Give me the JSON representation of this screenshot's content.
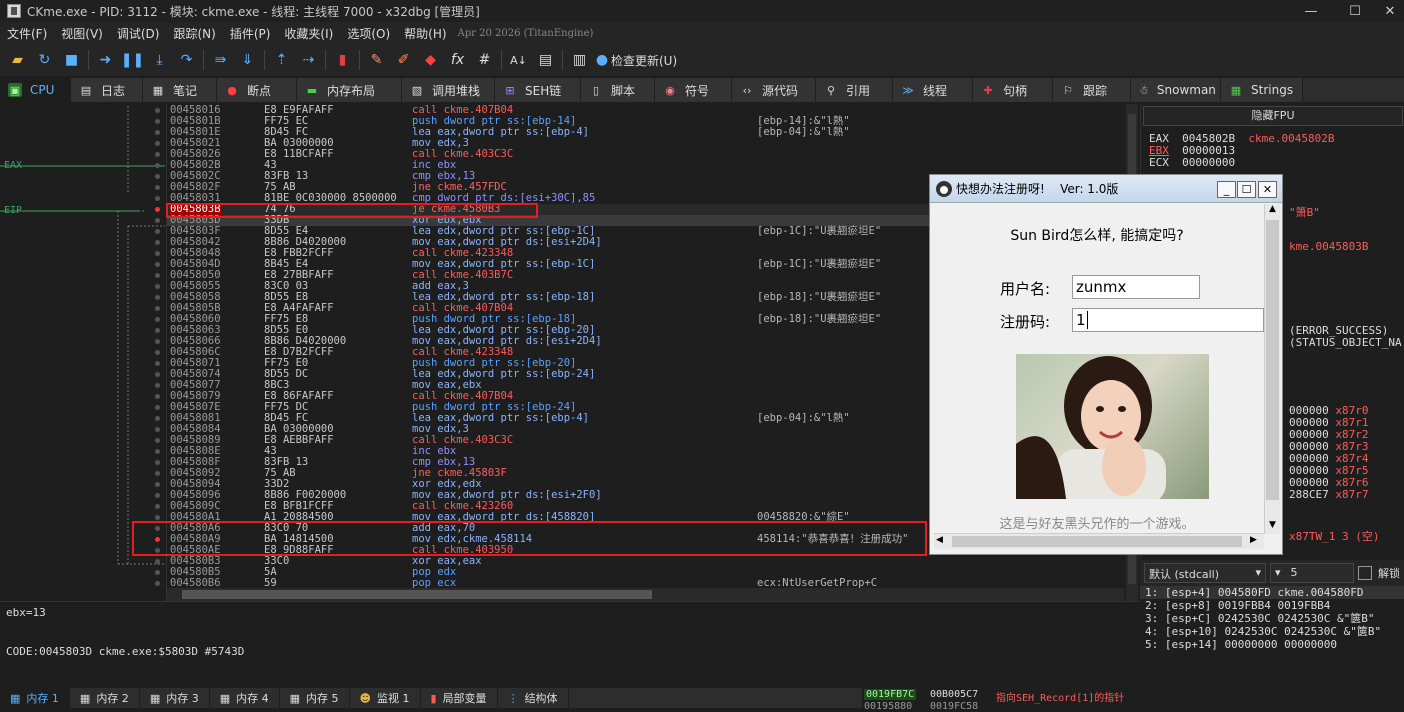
{
  "window": {
    "title": "CKme.exe - PID: 3112 - 模块: ckme.exe - 线程: 主线程 7000 - x32dbg [管理员]"
  },
  "menu": {
    "items": [
      "文件(F)",
      "视图(V)",
      "调试(D)",
      "跟踪(N)",
      "插件(P)",
      "收藏夹(I)",
      "选项(O)",
      "帮助(H)"
    ],
    "date": "Apr 20 2026 (TitanEngine)"
  },
  "toolbar": {
    "update_label": "检查更新(U)"
  },
  "tabs": [
    "CPU",
    "日志",
    "笔记",
    "断点",
    "内存布局",
    "调用堆栈",
    "SEH链",
    "脚本",
    "符号",
    "源代码",
    "引用",
    "线程",
    "句柄",
    "跟踪",
    "Snowman",
    "Strings"
  ],
  "gutter_labels": {
    "eax": "EAX",
    "eip": "EIP"
  },
  "disasm": [
    {
      "addr": "00458016",
      "bytes": "E8 E9FAFAFF",
      "asm": "call ckme.407B04",
      "kind": "call",
      "cmt": ""
    },
    {
      "addr": "0045801B",
      "bytes": "FF75 EC",
      "asm": "push dword ptr ss:[ebp-14]",
      "kind": "push",
      "cmt": "[ebp-14]:&\"l熱\""
    },
    {
      "addr": "0045801E",
      "bytes": "8D45 FC",
      "asm": "lea eax,dword ptr ss:[ebp-4]",
      "kind": "lea",
      "cmt": "[ebp-04]:&\"l熱\""
    },
    {
      "addr": "00458021",
      "bytes": "BA 03000000",
      "asm": "mov edx,3",
      "kind": "mov",
      "cmt": ""
    },
    {
      "addr": "00458026",
      "bytes": "E8 11BCFAFF",
      "asm": "call ckme.403C3C",
      "kind": "call",
      "cmt": ""
    },
    {
      "addr": "0045802B",
      "bytes": "43",
      "asm": "inc ebx",
      "kind": "cmp",
      "cmt": ""
    },
    {
      "addr": "0045802C",
      "bytes": "83FB 13",
      "asm": "cmp ebx,13",
      "kind": "cmp",
      "cmt": ""
    },
    {
      "addr": "0045802F",
      "bytes": "75 AB",
      "asm": "jne ckme.457FDC",
      "kind": "jmp",
      "cmt": ""
    },
    {
      "addr": "00458031",
      "bytes": "81BE 0C030000 8500000",
      "asm": "cmp dword ptr ds:[esi+30C],85",
      "kind": "cmp",
      "cmt": ""
    },
    {
      "addr": "0045803B",
      "bytes": "74 76",
      "asm": "je ckme.4580B3",
      "kind": "je",
      "cmt": ""
    },
    {
      "addr": "0045803D",
      "bytes": "33DB",
      "asm": "xor ebx,ebx",
      "kind": "mov",
      "cmt": ""
    },
    {
      "addr": "0045803F",
      "bytes": "8D55 E4",
      "asm": "lea edx,dword ptr ss:[ebp-1C]",
      "kind": "lea",
      "cmt": "[ebp-1C]:\"U裹翘瘀坦E\""
    },
    {
      "addr": "00458042",
      "bytes": "8B86 D4020000",
      "asm": "mov eax,dword ptr ds:[esi+2D4]",
      "kind": "mov",
      "cmt": ""
    },
    {
      "addr": "00458048",
      "bytes": "E8 FBB2FCFF",
      "asm": "call ckme.423348",
      "kind": "call",
      "cmt": ""
    },
    {
      "addr": "0045804D",
      "bytes": "8B45 E4",
      "asm": "mov eax,dword ptr ss:[ebp-1C]",
      "kind": "mov",
      "cmt": "[ebp-1C]:\"U裹翘瘀坦E\""
    },
    {
      "addr": "00458050",
      "bytes": "E8 27BBFAFF",
      "asm": "call ckme.403B7C",
      "kind": "call",
      "cmt": ""
    },
    {
      "addr": "00458055",
      "bytes": "83C0 03",
      "asm": "add eax,3",
      "kind": "mov",
      "cmt": ""
    },
    {
      "addr": "00458058",
      "bytes": "8D55 E8",
      "asm": "lea edx,dword ptr ss:[ebp-18]",
      "kind": "lea",
      "cmt": "[ebp-18]:\"U裹翘瘀坦E\""
    },
    {
      "addr": "0045805B",
      "bytes": "E8 A4FAFAFF",
      "asm": "call ckme.407B04",
      "kind": "call",
      "cmt": ""
    },
    {
      "addr": "00458060",
      "bytes": "FF75 E8",
      "asm": "push dword ptr ss:[ebp-18]",
      "kind": "push",
      "cmt": "[ebp-18]:\"U裹翘瘀坦E\""
    },
    {
      "addr": "00458063",
      "bytes": "8D55 E0",
      "asm": "lea edx,dword ptr ss:[ebp-20]",
      "kind": "lea",
      "cmt": ""
    },
    {
      "addr": "00458066",
      "bytes": "8B86 D4020000",
      "asm": "mov eax,dword ptr ds:[esi+2D4]",
      "kind": "mov",
      "cmt": ""
    },
    {
      "addr": "0045806C",
      "bytes": "E8 D7B2FCFF",
      "asm": "call ckme.423348",
      "kind": "call",
      "cmt": ""
    },
    {
      "addr": "00458071",
      "bytes": "FF75 E0",
      "asm": "push dword ptr ss:[ebp-20]",
      "kind": "push",
      "cmt": ""
    },
    {
      "addr": "00458074",
      "bytes": "8D55 DC",
      "asm": "lea edx,dword ptr ss:[ebp-24]",
      "kind": "lea",
      "cmt": ""
    },
    {
      "addr": "00458077",
      "bytes": "8BC3",
      "asm": "mov eax,ebx",
      "kind": "mov",
      "cmt": ""
    },
    {
      "addr": "00458079",
      "bytes": "E8 86FAFAFF",
      "asm": "call ckme.407B04",
      "kind": "call",
      "cmt": ""
    },
    {
      "addr": "0045807E",
      "bytes": "FF75 DC",
      "asm": "push dword ptr ss:[ebp-24]",
      "kind": "push",
      "cmt": ""
    },
    {
      "addr": "00458081",
      "bytes": "8D45 FC",
      "asm": "lea eax,dword ptr ss:[ebp-4]",
      "kind": "lea",
      "cmt": "[ebp-04]:&\"l熱\""
    },
    {
      "addr": "00458084",
      "bytes": "BA 03000000",
      "asm": "mov edx,3",
      "kind": "mov",
      "cmt": ""
    },
    {
      "addr": "00458089",
      "bytes": "E8 AEBBFAFF",
      "asm": "call ckme.403C3C",
      "kind": "call",
      "cmt": ""
    },
    {
      "addr": "0045808E",
      "bytes": "43",
      "asm": "inc ebx",
      "kind": "cmp",
      "cmt": ""
    },
    {
      "addr": "0045808F",
      "bytes": "83FB 13",
      "asm": "cmp ebx,13",
      "kind": "cmp",
      "cmt": ""
    },
    {
      "addr": "00458092",
      "bytes": "75 AB",
      "asm": "jne ckme.45803F",
      "kind": "jmp",
      "cmt": ""
    },
    {
      "addr": "00458094",
      "bytes": "33D2",
      "asm": "xor edx,edx",
      "kind": "mov",
      "cmt": ""
    },
    {
      "addr": "00458096",
      "bytes": "8B86 F0020000",
      "asm": "mov eax,dword ptr ds:[esi+2F0]",
      "kind": "mov",
      "cmt": ""
    },
    {
      "addr": "0045809C",
      "bytes": "E8 BFB1FCFF",
      "asm": "call ckme.423260",
      "kind": "call",
      "cmt": ""
    },
    {
      "addr": "004580A1",
      "bytes": "A1 20884500",
      "asm": "mov eax,dword ptr ds:[458820]",
      "kind": "mov",
      "cmt": "00458820:&\"綜E\""
    },
    {
      "addr": "004580A6",
      "bytes": "83C0 70",
      "asm": "add eax,70",
      "kind": "mov",
      "cmt": ""
    },
    {
      "addr": "004580A9",
      "bytes": "BA 14814500",
      "asm": "mov edx,ckme.458114",
      "kind": "mov",
      "cmt": "458114:\"恭喜恭喜！注册成功\""
    },
    {
      "addr": "004580AE",
      "bytes": "E8 9D88FAFF",
      "asm": "call ckme.403950",
      "kind": "call",
      "cmt": ""
    },
    {
      "addr": "004580B3",
      "bytes": "33C0",
      "asm": "xor eax,eax",
      "kind": "mov",
      "cmt": ""
    },
    {
      "addr": "004580B5",
      "bytes": "5A",
      "asm": "pop edx",
      "kind": "push",
      "cmt": ""
    },
    {
      "addr": "004580B6",
      "bytes": "59",
      "asm": "pop ecx",
      "kind": "push",
      "cmt": "ecx:NtUserGetProp+C"
    }
  ],
  "registers": {
    "header": "隐藏FPU",
    "rows": [
      {
        "name": "EAX",
        "value": "0045802B",
        "note": "ckme.0045802B"
      },
      {
        "name": "EBX",
        "value": "00000013",
        "note": ""
      },
      {
        "name": "ECX",
        "value": "00000000",
        "note": ""
      }
    ],
    "partial": [
      "\"箫B\"",
      "kme.0045803B",
      "(ERROR_SUCCESS)",
      "(STATUS_OBJECT_NA"
    ],
    "fpu": [
      {
        "v": "000000",
        "r": "x87r0"
      },
      {
        "v": "000000",
        "r": "x87r1"
      },
      {
        "v": "000000",
        "r": "x87r2"
      },
      {
        "v": "000000",
        "r": "x87r3"
      },
      {
        "v": "000000",
        "r": "x87r4"
      },
      {
        "v": "000000",
        "r": "x87r5"
      },
      {
        "v": "000000",
        "r": "x87r6"
      },
      {
        "v": "288CE7",
        "r": "x87r7"
      }
    ],
    "tw": "x87TW_1 3 (空)"
  },
  "info": {
    "line1": "ebx=13",
    "line2": "CODE:0045803D ckme.exe:$5803D #5743D"
  },
  "stackhdr": {
    "callconv": "默认 (stdcall)",
    "count": "5",
    "unlock": "解锁"
  },
  "stack": [
    "1: [esp+4] 004580FD ckme.004580FD",
    "2: [esp+8] 0019FBB4 0019FBB4",
    "3: [esp+C] 0242530C 0242530C &\"篋B\"",
    "4: [esp+10] 0242530C 0242530C &\"篋B\"",
    "5: [esp+14] 00000000 00000000"
  ],
  "bottomtabs": [
    "内存 1",
    "内存 2",
    "内存 3",
    "内存 4",
    "内存 5",
    "监视 1",
    "局部变量",
    "结构体"
  ],
  "dumpmini": {
    "a": "0019FB7C",
    "b": "00B005C7",
    "c": "指向SEH_Record[1]的指针",
    "d": "00195880",
    "e": "0019FC58"
  },
  "dialog": {
    "title": "快想办法注册呀!    Ver: 1.0版",
    "prompt": "Sun Bird怎么样, 能搞定吗?",
    "user_label": "用户名:",
    "user_value": "zunmx",
    "code_label": "注册码:",
    "code_value": "1",
    "caption": "这是与好友黑头兄作的一个游戏。"
  },
  "colors": {
    "accent": "#5ab0ff",
    "call": "#ff5a5a",
    "highlight": "#e02020",
    "eip_bg": "#a00000"
  }
}
